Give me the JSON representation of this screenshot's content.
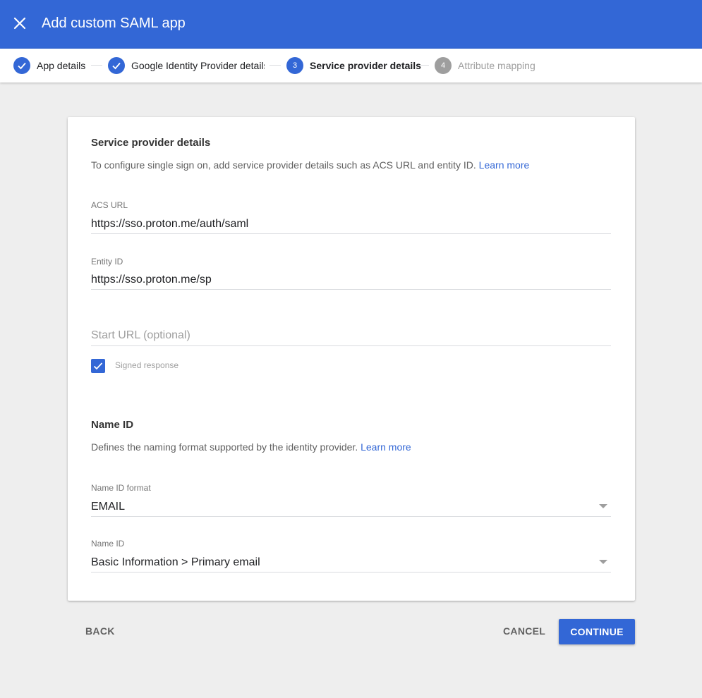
{
  "header": {
    "title": "Add custom SAML app",
    "close_icon": "close-icon"
  },
  "stepper": {
    "steps": [
      {
        "number": "1",
        "label": "App details",
        "status": "done"
      },
      {
        "number": "2",
        "label": "Google Identity Provider details",
        "status": "done"
      },
      {
        "number": "3",
        "label": "Service provider details",
        "status": "active"
      },
      {
        "number": "4",
        "label": "Attribute mapping",
        "status": "pending"
      }
    ]
  },
  "service_provider": {
    "title": "Service provider details",
    "description": "To configure single sign on, add service provider details such as ACS URL and entity ID.",
    "learn_more": "Learn more",
    "acs_url": {
      "label": "ACS URL",
      "value": "https://sso.proton.me/auth/saml"
    },
    "entity_id": {
      "label": "Entity ID",
      "value": "https://sso.proton.me/sp"
    },
    "start_url": {
      "placeholder": "Start URL (optional)",
      "value": ""
    },
    "signed_response": {
      "label": "Signed response",
      "checked": true
    }
  },
  "name_id_section": {
    "title": "Name ID",
    "description": "Defines the naming format supported by the identity provider.",
    "learn_more": "Learn more",
    "name_id_format": {
      "label": "Name ID format",
      "value": "EMAIL"
    },
    "name_id": {
      "label": "Name ID",
      "value": "Basic Information > Primary email"
    }
  },
  "footer": {
    "back_label": "BACK",
    "cancel_label": "CANCEL",
    "continue_label": "CONTINUE"
  },
  "colors": {
    "accent": "#3367d6",
    "background": "#eeeeee",
    "pending": "#9e9e9e"
  }
}
